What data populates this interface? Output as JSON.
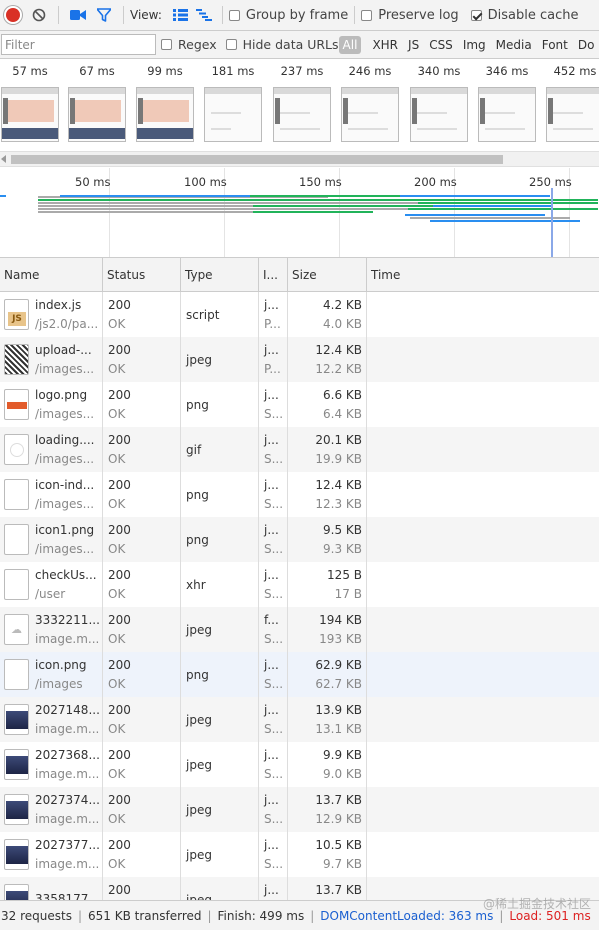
{
  "toolbar": {
    "view_label": "View:",
    "group_by_frame": "Group by frame",
    "preserve_log": "Preserve log",
    "disable_cache": "Disable cache"
  },
  "filter": {
    "placeholder": "Filter",
    "regex": "Regex",
    "hide_data_urls": "Hide data URLs",
    "types": [
      "All",
      "XHR",
      "JS",
      "CSS",
      "Img",
      "Media",
      "Font",
      "Do"
    ]
  },
  "filmstrip": {
    "times": [
      "57 ms",
      "67 ms",
      "99 ms",
      "181 ms",
      "237 ms",
      "246 ms",
      "340 ms",
      "346 ms",
      "452 ms"
    ]
  },
  "overview": {
    "labels": [
      "50 ms",
      "100 ms",
      "150 ms",
      "200 ms",
      "250 ms"
    ]
  },
  "table": {
    "headers": {
      "name": "Name",
      "status": "Status",
      "type": "Type",
      "initiator": "I...",
      "size": "Size",
      "time": "Time"
    },
    "rows": [
      {
        "name": "index.js",
        "path": "/js2.0/pa...",
        "status": "200",
        "status_text": "OK",
        "type": "script",
        "init1": "j...",
        "init2": "P...",
        "size": "4.2 KB",
        "content": "4.0 KB",
        "icon": "js-file-icon"
      },
      {
        "name": "upload-...",
        "path": "/images...",
        "status": "200",
        "status_text": "OK",
        "type": "jpeg",
        "init1": "j...",
        "init2": "P...",
        "size": "12.4 KB",
        "content": "12.2 KB",
        "icon": "qr-image-icon"
      },
      {
        "name": "logo.png",
        "path": "/images...",
        "status": "200",
        "status_text": "OK",
        "type": "png",
        "init1": "j...",
        "init2": "S...",
        "size": "6.6 KB",
        "content": "6.4 KB",
        "icon": "logo-image-icon"
      },
      {
        "name": "loading....",
        "path": "/images...",
        "status": "200",
        "status_text": "OK",
        "type": "gif",
        "init1": "j...",
        "init2": "S...",
        "size": "20.1 KB",
        "content": "19.9 KB",
        "icon": "gif-image-icon"
      },
      {
        "name": "icon-ind...",
        "path": "/images...",
        "status": "200",
        "status_text": "OK",
        "type": "png",
        "init1": "j...",
        "init2": "S...",
        "size": "12.4 KB",
        "content": "12.3 KB",
        "icon": "blank-image-icon"
      },
      {
        "name": "icon1.png",
        "path": "/images...",
        "status": "200",
        "status_text": "OK",
        "type": "png",
        "init1": "j...",
        "init2": "S...",
        "size": "9.5 KB",
        "content": "9.3 KB",
        "icon": "blank-image-icon"
      },
      {
        "name": "checkUs...",
        "path": "/user",
        "status": "200",
        "status_text": "OK",
        "type": "xhr",
        "init1": "j...",
        "init2": "S...",
        "size": "125 B",
        "content": "17 B",
        "icon": "blank-file-icon"
      },
      {
        "name": "3332211...",
        "path": "image.m...",
        "status": "200",
        "status_text": "OK",
        "type": "jpeg",
        "init1": "f...",
        "init2": "S...",
        "size": "194 KB",
        "content": "193 KB",
        "icon": "cloud-image-icon"
      },
      {
        "name": "icon.png",
        "path": "/images",
        "status": "200",
        "status_text": "OK",
        "type": "png",
        "init1": "j...",
        "init2": "S...",
        "size": "62.9 KB",
        "content": "62.7 KB",
        "icon": "blank-image-icon"
      },
      {
        "name": "2027148...",
        "path": "image.m...",
        "status": "200",
        "status_text": "OK",
        "type": "jpeg",
        "init1": "j...",
        "init2": "S...",
        "size": "13.9 KB",
        "content": "13.1 KB",
        "icon": "photo-image-icon"
      },
      {
        "name": "2027368...",
        "path": "image.m...",
        "status": "200",
        "status_text": "OK",
        "type": "jpeg",
        "init1": "j...",
        "init2": "S...",
        "size": "9.9 KB",
        "content": "9.0 KB",
        "icon": "photo-image-icon"
      },
      {
        "name": "2027374...",
        "path": "image.m...",
        "status": "200",
        "status_text": "OK",
        "type": "jpeg",
        "init1": "j...",
        "init2": "S...",
        "size": "13.7 KB",
        "content": "12.9 KB",
        "icon": "photo-image-icon"
      },
      {
        "name": "2027377...",
        "path": "image.m...",
        "status": "200",
        "status_text": "OK",
        "type": "jpeg",
        "init1": "j...",
        "init2": "S...",
        "size": "10.5 KB",
        "content": "9.7 KB",
        "icon": "photo-image-icon"
      },
      {
        "name": "3358177...",
        "path": "",
        "status": "200",
        "status_text": "",
        "type": "jpeg",
        "init1": "j...",
        "init2": "",
        "size": "13.7 KB",
        "content": "",
        "icon": "photo-image-icon"
      }
    ]
  },
  "status": {
    "requests": "32 requests",
    "transferred": "651 KB transferred",
    "finish": "Finish: 499 ms",
    "dom": "DOMContentLoaded: 363 ms",
    "load": "Load: 501 ms"
  },
  "watermark": "@稀土掘金技术社区",
  "colors": {
    "record": "#d93025",
    "accent": "#1a73e8",
    "dom_line": "#1a5fd0",
    "load_line": "#d22"
  }
}
